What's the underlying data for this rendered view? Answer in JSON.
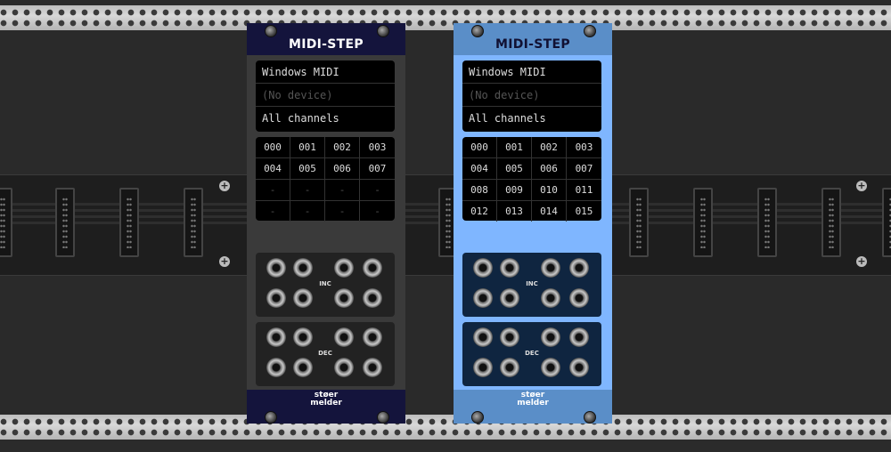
{
  "modules": [
    {
      "title": "MIDI-STEP",
      "driver": "Windows MIDI",
      "device": "(No device)",
      "channel": "All channels",
      "cells": [
        "000",
        "001",
        "002",
        "003",
        "004",
        "005",
        "006",
        "007",
        "-",
        "-",
        "-",
        "-",
        "-",
        "-",
        "-",
        "-"
      ],
      "inc_label": "INC",
      "dec_label": "DEC",
      "brand_line1": "støer",
      "brand_line2": "melder",
      "colors": {
        "panel": "#3a3a3a",
        "header": "#14143c",
        "title": "#ffffff",
        "jackpanel": "#222222"
      }
    },
    {
      "title": "MIDI-STEP",
      "driver": "Windows MIDI",
      "device": "(No device)",
      "channel": "All channels",
      "cells": [
        "000",
        "001",
        "002",
        "003",
        "004",
        "005",
        "006",
        "007",
        "008",
        "009",
        "010",
        "011",
        "012",
        "013",
        "014",
        "015"
      ],
      "inc_label": "INC",
      "dec_label": "DEC",
      "brand_line1": "støer",
      "brand_line2": "melder",
      "colors": {
        "panel": "#7fb6ff",
        "header": "#5a8ec8",
        "title": "#111133",
        "jackpanel": "#0f2540"
      }
    }
  ]
}
